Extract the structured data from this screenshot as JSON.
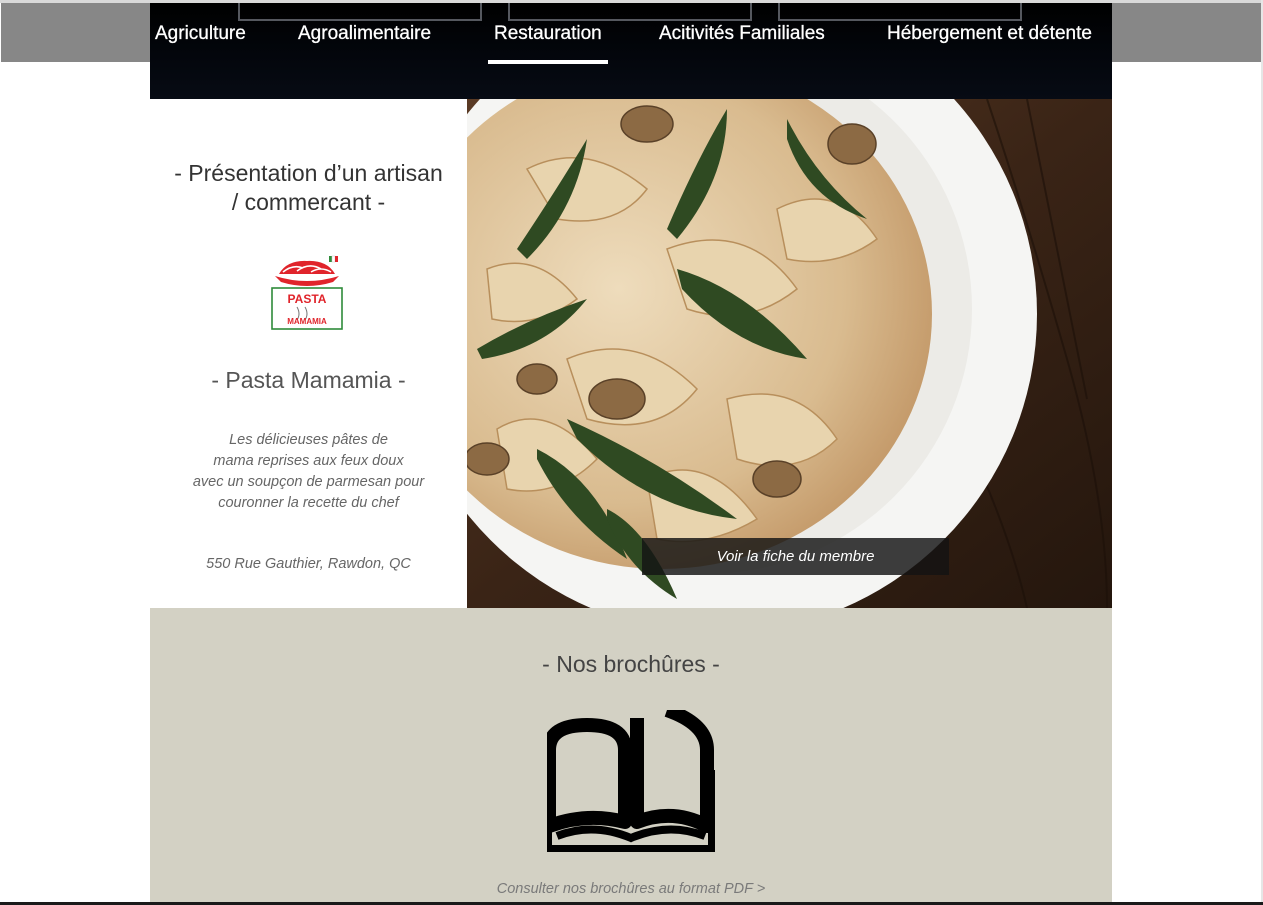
{
  "nav": {
    "items": [
      {
        "label": "Agriculture"
      },
      {
        "label": "Agroalimentaire"
      },
      {
        "label": "Restauration"
      },
      {
        "label": "Acitivités Familiales"
      },
      {
        "label": "Hébergement et détente"
      }
    ],
    "active_label": "Restauration"
  },
  "feature": {
    "section_title_line1": "- Présentation d’un artisan",
    "section_title_line2": "/ commercant -",
    "logo": {
      "line1": "PASTA",
      "line2": "MAMAMIA"
    },
    "member_name": "- Pasta Mamamia -",
    "description": [
      "Les délicieuses pâtes de",
      "mama reprises aux feux doux",
      "avec un soupçon de parmesan pour",
      "couronner la recette du chef"
    ],
    "address": "550 Rue Gauthier, Rawdon, QC",
    "button_label": "Voir la fiche du membre",
    "photo_icon": "pasta-dish-photo"
  },
  "brochures": {
    "title": "- Nos brochûres -",
    "icon": "open-book-icon",
    "link_label": "Consulter nos brochûres au format PDF >"
  },
  "colors": {
    "nav_background": "#000000",
    "brochures_background": "#d3d1c4",
    "logo_red": "#e0242b",
    "logo_green": "#2e8b3a"
  }
}
